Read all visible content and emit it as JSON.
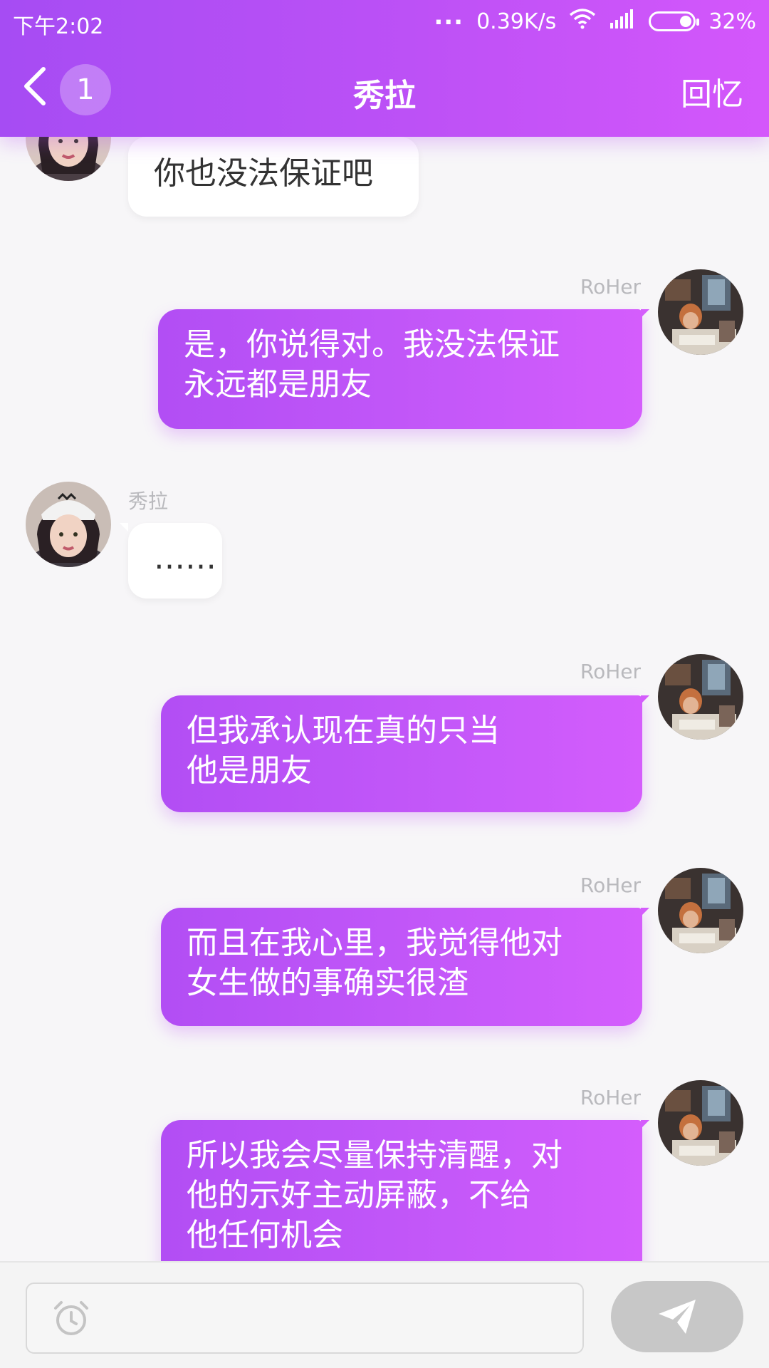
{
  "status_bar": {
    "time": "下午2:02",
    "dots": "...",
    "speed": "0.39K/s",
    "battery": "32%"
  },
  "nav": {
    "unread_count": "1",
    "title": "秀拉",
    "right_action": "回忆"
  },
  "messages": [
    {
      "direction": "in",
      "sender": "",
      "text": "你也没法保证吧"
    },
    {
      "direction": "out",
      "sender": "RoHer",
      "text": "是，你说得对。我没法保证\n永远都是朋友"
    },
    {
      "direction": "in",
      "sender": "秀拉",
      "text": "……"
    },
    {
      "direction": "out",
      "sender": "RoHer",
      "text": "但我承认现在真的只当\n他是朋友"
    },
    {
      "direction": "out",
      "sender": "RoHer",
      "text": "而且在我心里，我觉得他对\n女生做的事确实很渣"
    },
    {
      "direction": "out",
      "sender": "RoHer",
      "text": "所以我会尽量保持清醒，对\n他的示好主动屏蔽，不给\n他任何机会"
    }
  ],
  "composer": {
    "input_value": "",
    "input_placeholder": ""
  },
  "icons": {
    "back": "chevron-left-icon",
    "wifi": "wifi-icon",
    "signal": "signal-icon",
    "battery": "battery-icon",
    "alarm": "alarm-clock-icon",
    "send": "paper-plane-icon"
  },
  "colors": {
    "header_start": "#a64cf3",
    "header_end": "#d457fb",
    "outgoing_bubble": "#c458f9",
    "incoming_bubble": "#ffffff",
    "background": "#f7f6f8",
    "send_button": "#c7c7c7"
  }
}
